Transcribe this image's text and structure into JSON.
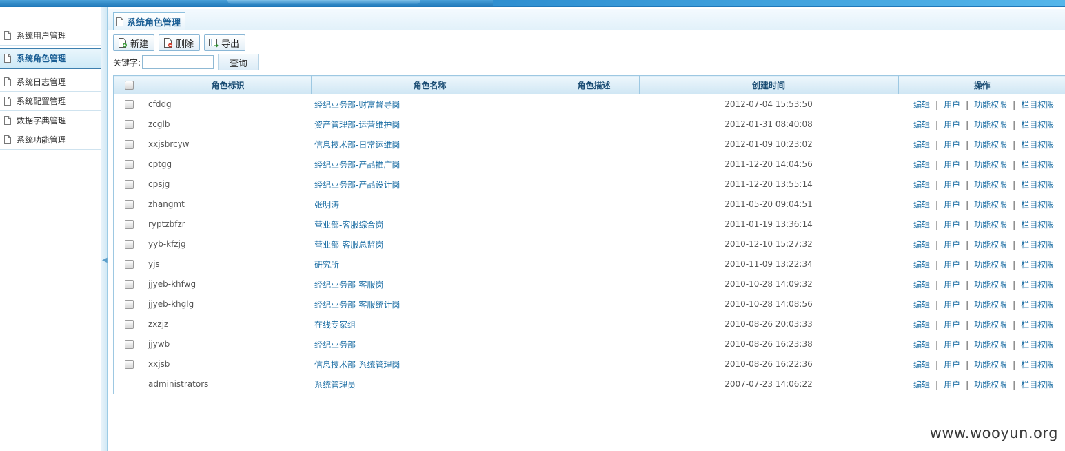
{
  "sidebar": {
    "items": [
      {
        "label": "系统用户管理"
      },
      {
        "label": "系统角色管理"
      },
      {
        "label": "系统日志管理"
      },
      {
        "label": "系统配置管理"
      },
      {
        "label": "数据字典管理"
      },
      {
        "label": "系统功能管理"
      }
    ]
  },
  "panel": {
    "title": "系统角色管理"
  },
  "toolbar": {
    "new_label": "新建",
    "delete_label": "删除",
    "export_label": "导出"
  },
  "search": {
    "label": "关键字:",
    "value": "",
    "button": "查询"
  },
  "table": {
    "headers": {
      "id": "角色标识",
      "name": "角色名称",
      "desc": "角色描述",
      "time": "创建时间",
      "ops": "操作"
    },
    "rows": [
      {
        "id": "cfddg",
        "name": "经纪业务部-财富督导岗",
        "desc": "",
        "time": "2012-07-04 15:53:50"
      },
      {
        "id": "zcglb",
        "name": "资产管理部-运营维护岗",
        "desc": "",
        "time": "2012-01-31 08:40:08"
      },
      {
        "id": "xxjsbrcyw",
        "name": "信息技术部-日常运维岗",
        "desc": "",
        "time": "2012-01-09 10:23:02"
      },
      {
        "id": "cptgg",
        "name": "经纪业务部-产品推广岗",
        "desc": "",
        "time": "2011-12-20 14:04:56"
      },
      {
        "id": "cpsjg",
        "name": "经纪业务部-产品设计岗",
        "desc": "",
        "time": "2011-12-20 13:55:14"
      },
      {
        "id": "zhangmt",
        "name": "张明涛",
        "desc": "",
        "time": "2011-05-20 09:04:51"
      },
      {
        "id": "ryptzbfzr",
        "name": "营业部-客服综合岗",
        "desc": "",
        "time": "2011-01-19 13:36:14"
      },
      {
        "id": "yyb-kfzjg",
        "name": "营业部-客服总监岗",
        "desc": "",
        "time": "2010-12-10 15:27:32"
      },
      {
        "id": "yjs",
        "name": "研究所",
        "desc": "",
        "time": "2010-11-09 13:22:34"
      },
      {
        "id": "jjyeb-khfwg",
        "name": "经纪业务部-客服岗",
        "desc": "",
        "time": "2010-10-28 14:09:32"
      },
      {
        "id": "jjyeb-khglg",
        "name": "经纪业务部-客服统计岗",
        "desc": "",
        "time": "2010-10-28 14:08:56"
      },
      {
        "id": "zxzjz",
        "name": "在线专家组",
        "desc": "",
        "time": "2010-08-26 20:03:33"
      },
      {
        "id": "jjywb",
        "name": "经纪业务部",
        "desc": "",
        "time": "2010-08-26 16:23:38"
      },
      {
        "id": "xxjsb",
        "name": "信息技术部-系统管理岗",
        "desc": "",
        "time": "2010-08-26 16:22:36"
      },
      {
        "id": "administrators",
        "name": "系统管理员",
        "desc": "",
        "time": "2007-07-23 14:06:22",
        "no_checkbox": true
      }
    ],
    "ops": {
      "edit": "编辑",
      "user": "用户",
      "func": "功能权限",
      "column": "栏目权限",
      "separator": "|"
    }
  },
  "watermark": "www.wooyun.org",
  "colors": {
    "accent": "#1c6ea4",
    "border": "#9dc8e2",
    "header_bg": "#cfe6f4"
  }
}
